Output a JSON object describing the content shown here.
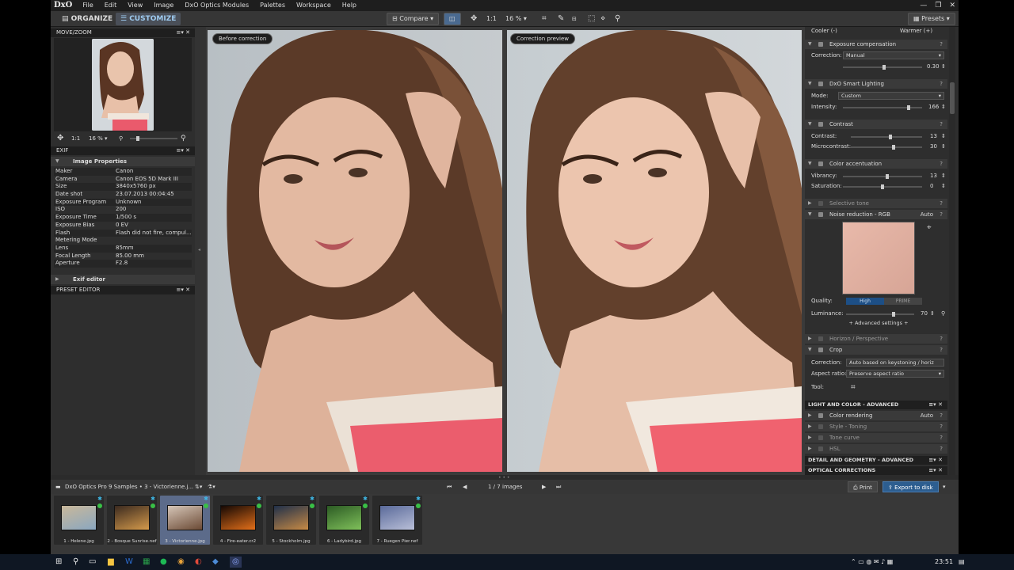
{
  "app": {
    "logo": "DxO",
    "menu": [
      "File",
      "Edit",
      "View",
      "Image",
      "DxO Optics Modules",
      "Palettes",
      "Workspace",
      "Help"
    ]
  },
  "toolbar": {
    "organize": "ORGANIZE",
    "customize": "CUSTOMIZE",
    "compare": "Compare",
    "zoom_fit": "1:1",
    "zoom": "16 %",
    "presets": "Presets"
  },
  "left": {
    "movezoom_title": "MOVE/ZOOM",
    "zoom_fit": "1:1",
    "zoom": "16 %",
    "exif_title": "EXIF",
    "image_properties": "Image Properties",
    "exif_rows": [
      {
        "k": "Maker",
        "v": "Canon"
      },
      {
        "k": "Camera",
        "v": "Canon EOS 5D Mark III"
      },
      {
        "k": "Size",
        "v": "3840x5760 px"
      },
      {
        "k": "Date shot",
        "v": "23.07.2013 00:04:45"
      },
      {
        "k": "Exposure Program",
        "v": "Unknown"
      },
      {
        "k": "ISO",
        "v": "200"
      },
      {
        "k": "Exposure Time",
        "v": "1/500 s"
      },
      {
        "k": "Exposure Bias",
        "v": "0 EV"
      },
      {
        "k": "Flash",
        "v": "Flash did not fire, compul..."
      },
      {
        "k": "Metering Mode",
        "v": ""
      },
      {
        "k": "Lens",
        "v": "85mm"
      },
      {
        "k": "Focal Length",
        "v": "85.00 mm"
      },
      {
        "k": "Aperture",
        "v": "F2.8"
      }
    ],
    "exif_editor": "Exif editor",
    "preset_editor_title": "PRESET EDITOR"
  },
  "viewer": {
    "before_label": "Before correction",
    "after_label": "Correction preview"
  },
  "right": {
    "cooler": "Cooler (-)",
    "warmer": "Warmer (+)",
    "exposure": {
      "title": "Exposure compensation",
      "correction_label": "Correction:",
      "correction_value": "Manual",
      "value": "0.30",
      "level": 0.52
    },
    "smart_lighting": {
      "title": "DxO Smart Lighting",
      "mode_label": "Mode:",
      "mode_value": "Custom",
      "intensity_label": "Intensity:",
      "intensity_value": "166",
      "level": 0.83
    },
    "contrast": {
      "title": "Contrast",
      "contrast_label": "Contrast:",
      "contrast_value": "13",
      "micro_label": "Microcontrast:",
      "micro_value": "30",
      "contrast_level": 0.56,
      "micro_level": 0.6
    },
    "color_accentuation": {
      "title": "Color accentuation",
      "vibrancy_label": "Vibrancy:",
      "vibrancy_value": "13",
      "saturation_label": "Saturation:",
      "saturation_value": "0",
      "vibrancy_level": 0.56,
      "saturation_level": 0.5
    },
    "selective_tone": "Selective tone",
    "noise": {
      "title": "Noise reduction - RGB",
      "auto": "Auto",
      "quality_label": "Quality:",
      "quality_high": "High",
      "quality_prime": "PRIME",
      "luminance_label": "Luminance:",
      "luminance_value": "70",
      "level": 0.7,
      "advanced": "+ Advanced settings +"
    },
    "horizon": "Horizon / Perspective",
    "crop": {
      "title": "Crop",
      "correction_label": "Correction:",
      "correction_value": "Auto based on keystoning / horiz",
      "aspect_label": "Aspect ratio:",
      "aspect_value": "Preserve aspect ratio",
      "tool_label": "Tool:"
    },
    "light_color_adv": "LIGHT AND COLOR - ADVANCED",
    "color_rendering": {
      "title": "Color rendering",
      "auto": "Auto"
    },
    "style_toning": "Style - Toning",
    "tone_curve": "Tone curve",
    "hsl": "HSL",
    "detail_geometry_adv": "DETAIL AND GEOMETRY - ADVANCED",
    "optical_corrections": "OPTICAL CORRECTIONS"
  },
  "filmstrip": {
    "path": "DxO Optics Pro 9 Samples • 3 - Victorienne.j...",
    "counter": "1 / 7",
    "counter_suffix": "images",
    "print": "Print",
    "export": "Export to disk",
    "items": [
      {
        "name": "1 - Helene.jpg",
        "c1": "#c9b89a",
        "c2": "#8aa7c0"
      },
      {
        "name": "2 - Bosque Sunrise.nef",
        "c1": "#3b2a1f",
        "c2": "#d49a4b"
      },
      {
        "name": "3 - Victorienne.jpg",
        "c1": "#d6c6b8",
        "c2": "#6b4a35"
      },
      {
        "name": "4 - Fire-eater.cr2",
        "c1": "#140804",
        "c2": "#e36f19"
      },
      {
        "name": "5 - Stockholm.jpg",
        "c1": "#20304a",
        "c2": "#c78a45"
      },
      {
        "name": "6 - Ladybird.jpg",
        "c1": "#2c5b24",
        "c2": "#7fc05a"
      },
      {
        "name": "7 - Ruegen Pier.nef",
        "c1": "#5a6a9a",
        "c2": "#b9bfd8"
      }
    ]
  },
  "taskbar": {
    "time": "23:51"
  }
}
